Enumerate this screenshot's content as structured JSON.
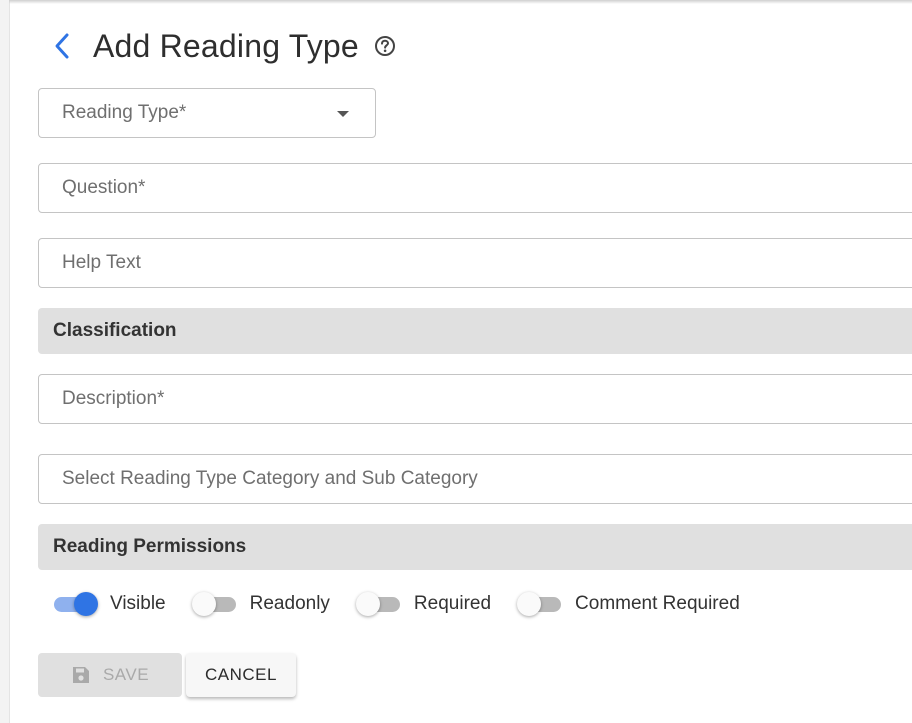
{
  "header": {
    "title": "Add Reading Type",
    "back_icon": "chevron-left-icon",
    "help_icon": "help-circle-icon"
  },
  "form": {
    "reading_type": {
      "placeholder": "Reading Type*",
      "value": ""
    },
    "question": {
      "placeholder": "Question*",
      "value": ""
    },
    "help_text": {
      "placeholder": "Help Text",
      "value": ""
    },
    "classification_title": "Classification",
    "description": {
      "placeholder": "Description*",
      "value": ""
    },
    "category": {
      "placeholder": "Select Reading Type Category and Sub Category",
      "value": ""
    },
    "permissions_title": "Reading Permissions",
    "permissions": [
      {
        "label": "Visible",
        "checked": true
      },
      {
        "label": "Readonly",
        "checked": false
      },
      {
        "label": "Required",
        "checked": false
      },
      {
        "label": "Comment Required",
        "checked": false
      }
    ]
  },
  "actions": {
    "save_label": "SAVE",
    "save_disabled": true,
    "cancel_label": "CANCEL"
  },
  "colors": {
    "accent": "#2f74e4",
    "accent_track": "#8fb1ee",
    "section_bg": "#e0e0e0"
  }
}
